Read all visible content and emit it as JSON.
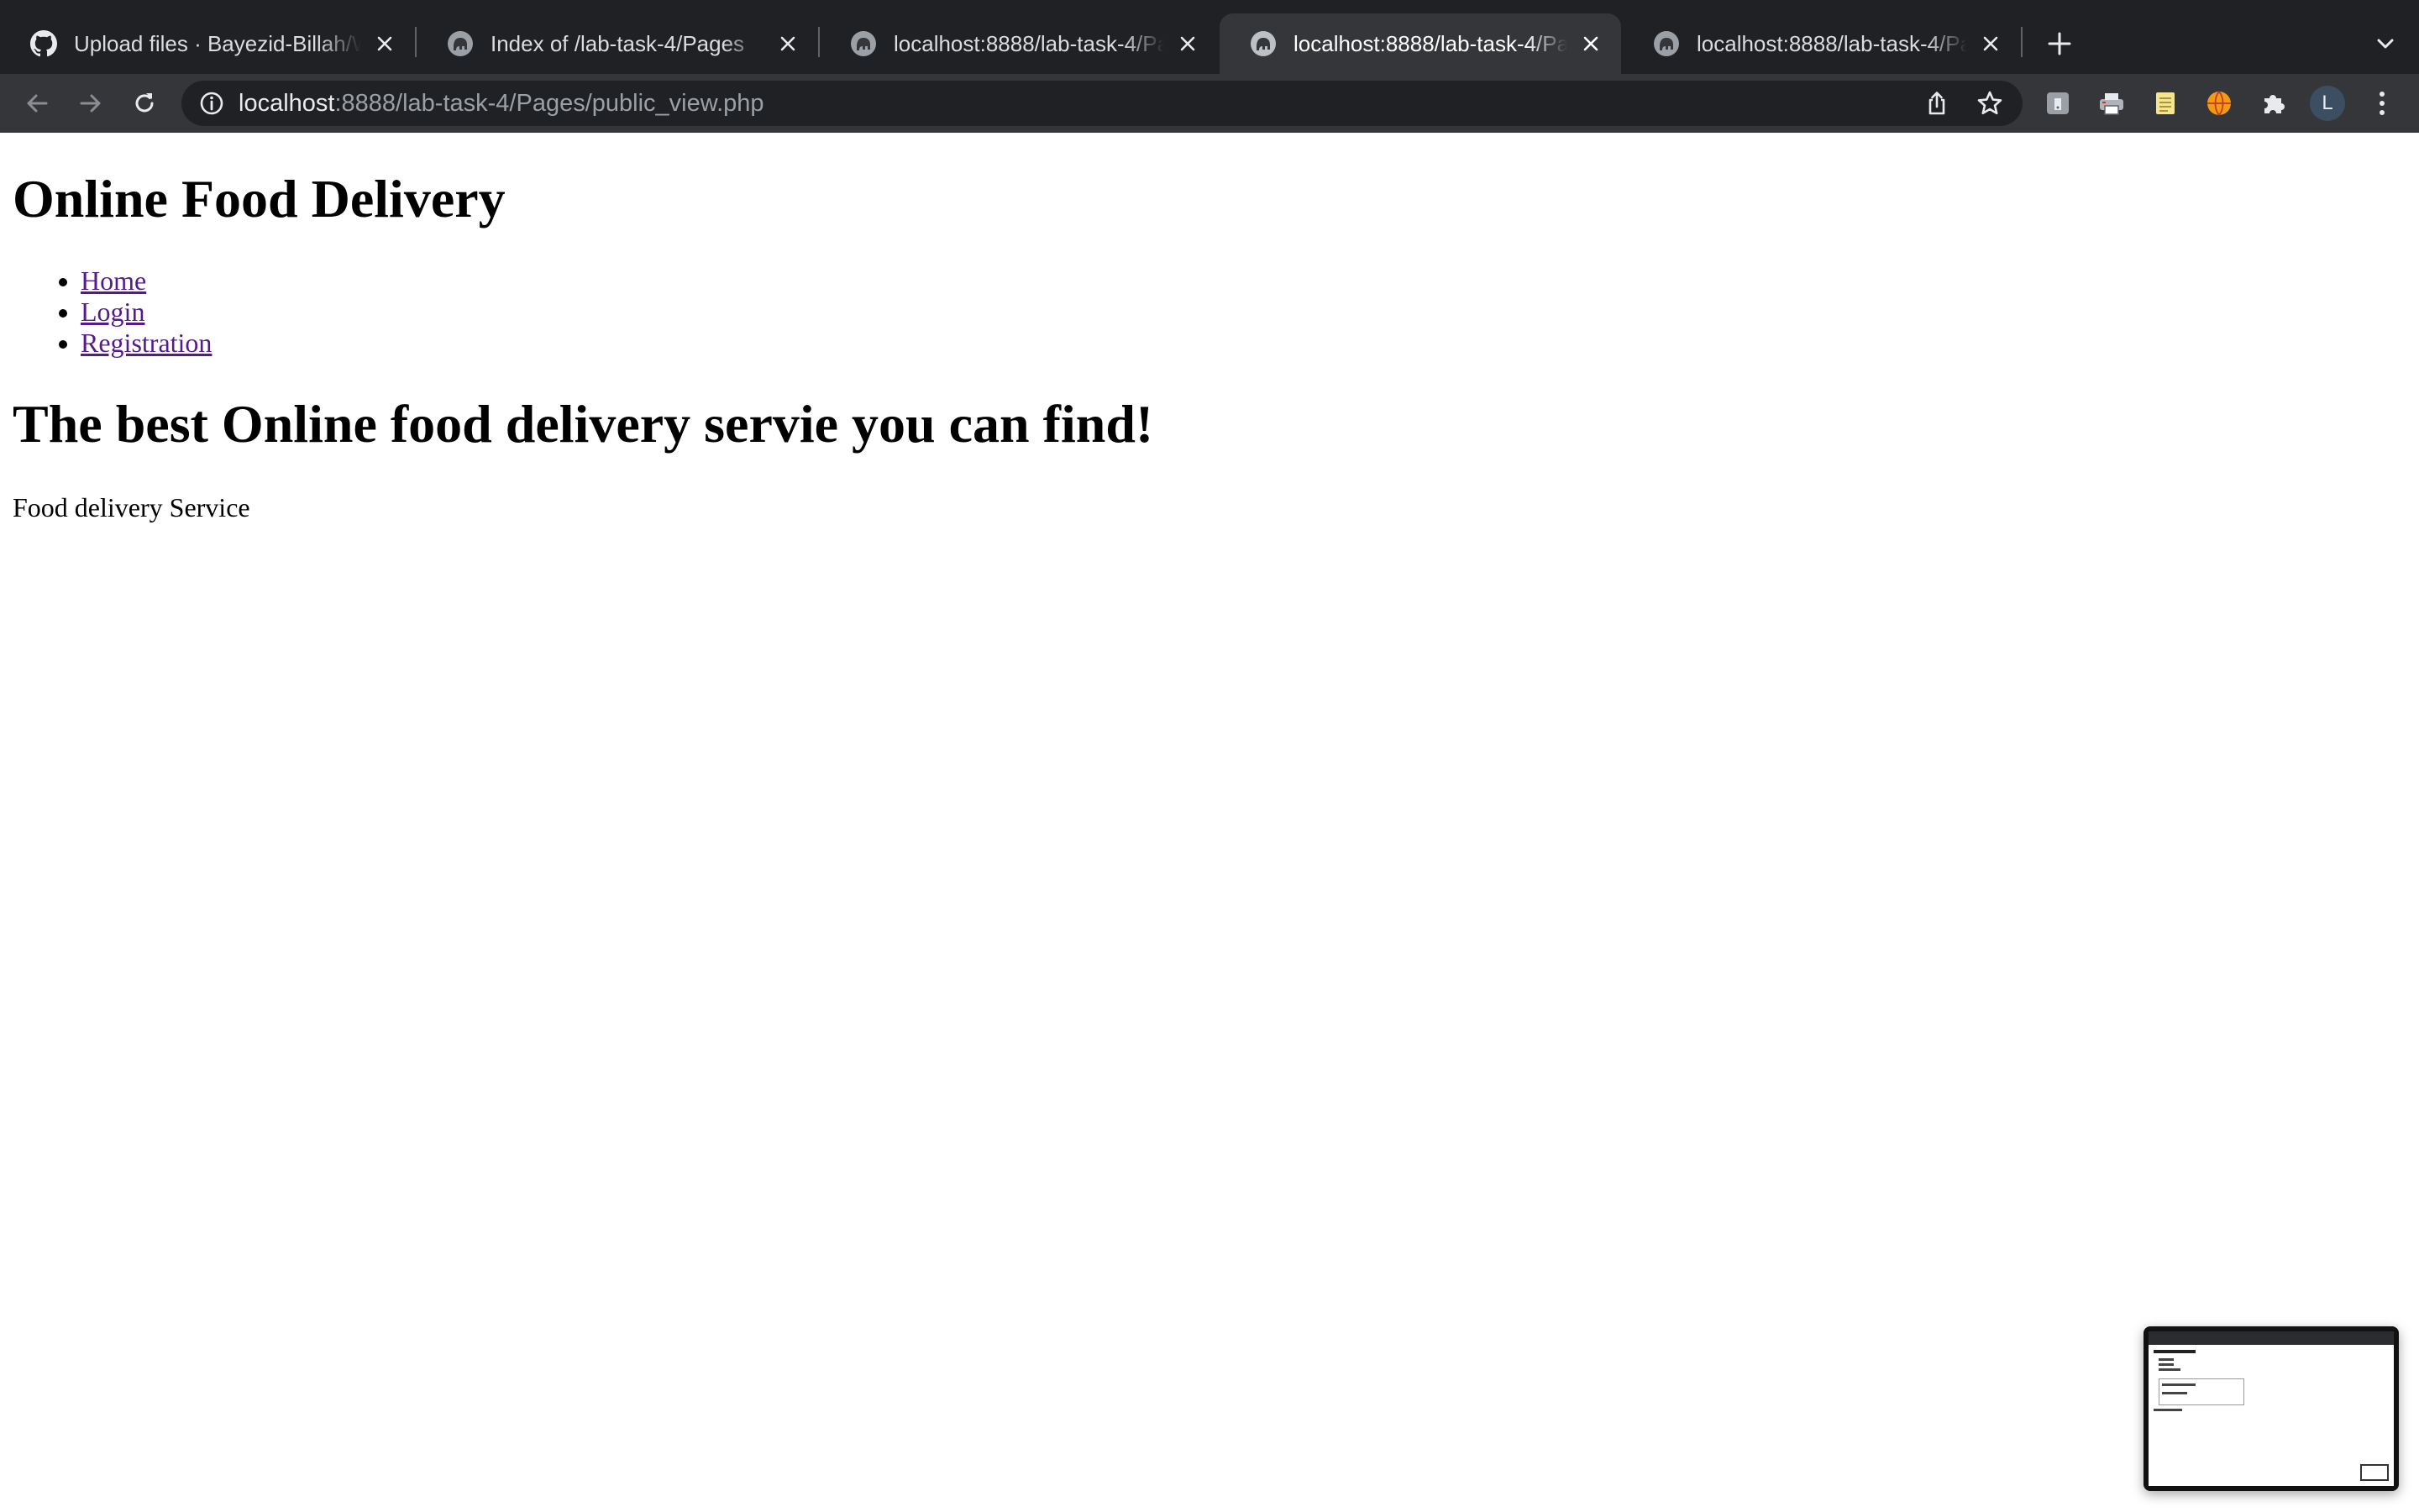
{
  "browser": {
    "tabs": [
      {
        "title": "Upload files · Bayezid-Billah/W",
        "favicon": "github-icon",
        "active": false
      },
      {
        "title": "Index of /lab-task-4/Pages",
        "favicon": "php-elephant-icon",
        "active": false
      },
      {
        "title": "localhost:8888/lab-task-4/Pag",
        "favicon": "php-elephant-icon",
        "active": false
      },
      {
        "title": "localhost:8888/lab-task-4/Pag",
        "favicon": "php-elephant-icon",
        "active": true
      },
      {
        "title": "localhost:8888/lab-task-4/Pag",
        "favicon": "php-elephant-icon",
        "active": false
      }
    ],
    "address": {
      "host": "localhost",
      "path": ":8888/lab-task-4/Pages/public_view.php"
    },
    "profile_initial": "L",
    "extensions": [
      "tablet-icon",
      "printer-icon",
      "notepad-icon",
      "orange-ball-icon",
      "puzzle-piece-icon"
    ]
  },
  "page": {
    "site_title": "Online Food Delivery",
    "nav": [
      {
        "label": "Home"
      },
      {
        "label": "Login"
      },
      {
        "label": "Registration"
      }
    ],
    "tagline": "The best Online food delivery servie you can find!",
    "description": "Food delivery Service"
  }
}
